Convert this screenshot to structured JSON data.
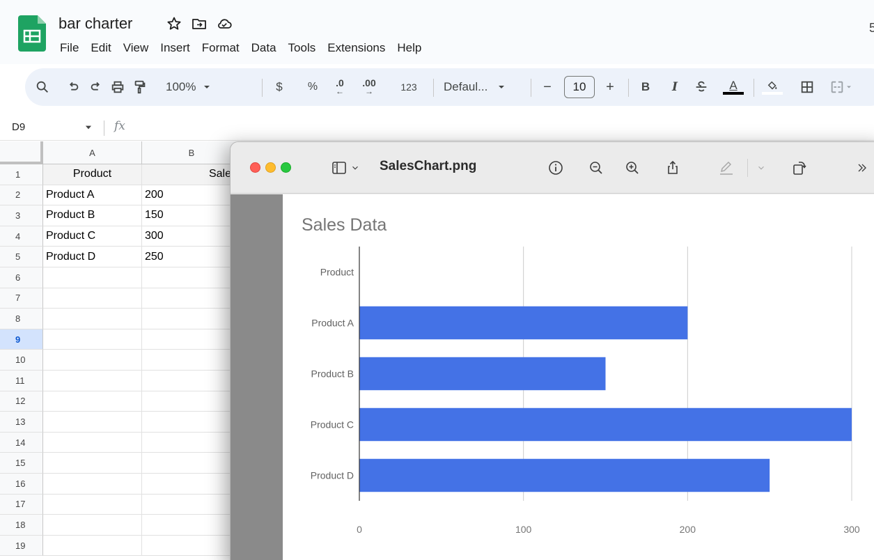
{
  "app": {
    "doc_title": "bar charter",
    "menu": [
      "File",
      "Edit",
      "View",
      "Insert",
      "Format",
      "Data",
      "Tools",
      "Extensions",
      "Help"
    ],
    "edge_glyph": "5"
  },
  "toolbar": {
    "zoom": "100%",
    "currency": "$",
    "percent": "%",
    "decrease_decimal": ".0",
    "increase_decimal": ".00",
    "number_format": "123",
    "font": "Defaul...",
    "font_size": "10",
    "minus": "−",
    "plus": "+",
    "bold": "B",
    "italic": "I",
    "text_color_letter": "A"
  },
  "formula_bar": {
    "cell_ref": "D9",
    "fx": "fx"
  },
  "sheet": {
    "columns": [
      "A",
      "B"
    ],
    "rows": [
      "1",
      "2",
      "3",
      "4",
      "5",
      "6",
      "7",
      "8",
      "9",
      "10",
      "11",
      "12",
      "13",
      "14",
      "15",
      "16",
      "17",
      "18",
      "19"
    ],
    "selected_row": "9",
    "header": [
      "Product",
      "Sales"
    ],
    "data": [
      [
        "Product A",
        "200"
      ],
      [
        "Product B",
        "150"
      ],
      [
        "Product C",
        "300"
      ],
      [
        "Product D",
        "250"
      ]
    ]
  },
  "preview": {
    "filename": "SalesChart.png"
  },
  "chart_data": {
    "type": "bar",
    "orientation": "horizontal",
    "title": "Sales Data",
    "categories": [
      "Product",
      "Product A",
      "Product B",
      "Product C",
      "Product D"
    ],
    "values": [
      0,
      200,
      150,
      300,
      250
    ],
    "xlim": [
      0,
      300
    ],
    "ticks": [
      0,
      100,
      200,
      300
    ],
    "grid": true,
    "bar_color": "#4472e6",
    "title_color": "#757575"
  }
}
